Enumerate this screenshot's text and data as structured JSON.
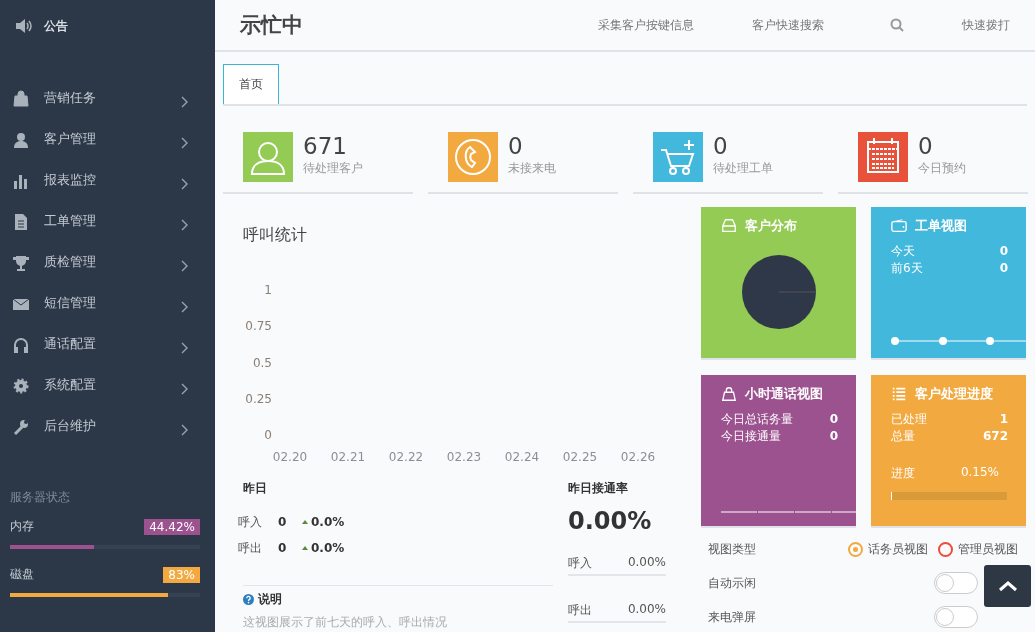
{
  "sidebar": {
    "announcement": "公告",
    "items": [
      {
        "label": "营销任务"
      },
      {
        "label": "客户管理"
      },
      {
        "label": "报表监控"
      },
      {
        "label": "工单管理"
      },
      {
        "label": "质检管理"
      },
      {
        "label": "短信管理"
      },
      {
        "label": "通话配置"
      },
      {
        "label": "系统配置"
      },
      {
        "label": "后台维护"
      }
    ],
    "server_status": {
      "title": "服务器状态",
      "items": [
        {
          "label": "内存",
          "value": "44.42%",
          "level": 0.4442,
          "color": "#9b528f"
        },
        {
          "label": "磁盘",
          "value": "83%",
          "level": 0.83,
          "color": "#f1a940"
        }
      ]
    }
  },
  "header": {
    "title": "示忙中",
    "links": [
      "采集客户按键信息",
      "客户快速搜索",
      "快速拨打"
    ]
  },
  "tabs": [
    {
      "label": "首页",
      "selected": true
    }
  ],
  "stats": [
    {
      "value": "671",
      "label": "待处理客户",
      "color": "#94cb55"
    },
    {
      "value": "0",
      "label": "未接来电",
      "color": "#f1a940"
    },
    {
      "value": "0",
      "label": "待处理工单",
      "color": "#42b8dc"
    },
    {
      "value": "0",
      "label": "今日预约",
      "color": "#e8513a"
    }
  ],
  "call_stats": {
    "title": "呼叫统计",
    "chart_data": {
      "type": "line",
      "categories": [
        "02.20",
        "02.21",
        "02.22",
        "02.23",
        "02.24",
        "02.25",
        "02.26"
      ],
      "ylim": [
        0,
        1
      ],
      "yticks": [
        0,
        0.25,
        0.5,
        0.75,
        1
      ]
    }
  },
  "yesterday": {
    "title": "昨日",
    "rows": [
      {
        "label": "呼入",
        "count": "0",
        "change": "0.0%"
      },
      {
        "label": "呼出",
        "count": "0",
        "change": "0.0%"
      }
    ]
  },
  "answer_rate": {
    "title": "昨日接通率",
    "value": "0.00%",
    "rows": [
      {
        "label": "呼入",
        "value": "0.00%"
      },
      {
        "label": "呼出",
        "value": "0.00%"
      }
    ]
  },
  "note": {
    "title": "说明",
    "text": "这视图展示了前七天的呼入、呼出情况"
  },
  "tiles": [
    {
      "kind": "pie",
      "title": "客户分布",
      "color": "#94cb55"
    },
    {
      "kind": "line",
      "title": "工单视图",
      "color": "#42b8dc",
      "rows": [
        {
          "label": "今天",
          "value": "0"
        },
        {
          "label": "前6天",
          "value": "0"
        }
      ]
    },
    {
      "kind": "dash",
      "title": "小时通话视图",
      "color": "#9b528f",
      "rows": [
        {
          "label": "今日总话务量",
          "value": "0"
        },
        {
          "label": "今日接通量",
          "value": "0"
        }
      ]
    },
    {
      "kind": "progress",
      "title": "客户处理进度",
      "color": "#f1a940",
      "rows": [
        {
          "label": "已处理",
          "value": "1"
        },
        {
          "label": "总量",
          "value": "672"
        }
      ],
      "progress": {
        "label": "进度",
        "reading": "0.15%",
        "level": 0.0015
      }
    }
  ],
  "settings": [
    {
      "kind": "radio",
      "label": "视图类型",
      "options": [
        {
          "label": "话务员视图",
          "selected": true
        },
        {
          "label": "管理员视图",
          "selected": false
        }
      ]
    },
    {
      "kind": "toggle",
      "label": "自动示闲",
      "on": false
    },
    {
      "kind": "toggle",
      "label": "来电弹屏",
      "on": false
    }
  ]
}
